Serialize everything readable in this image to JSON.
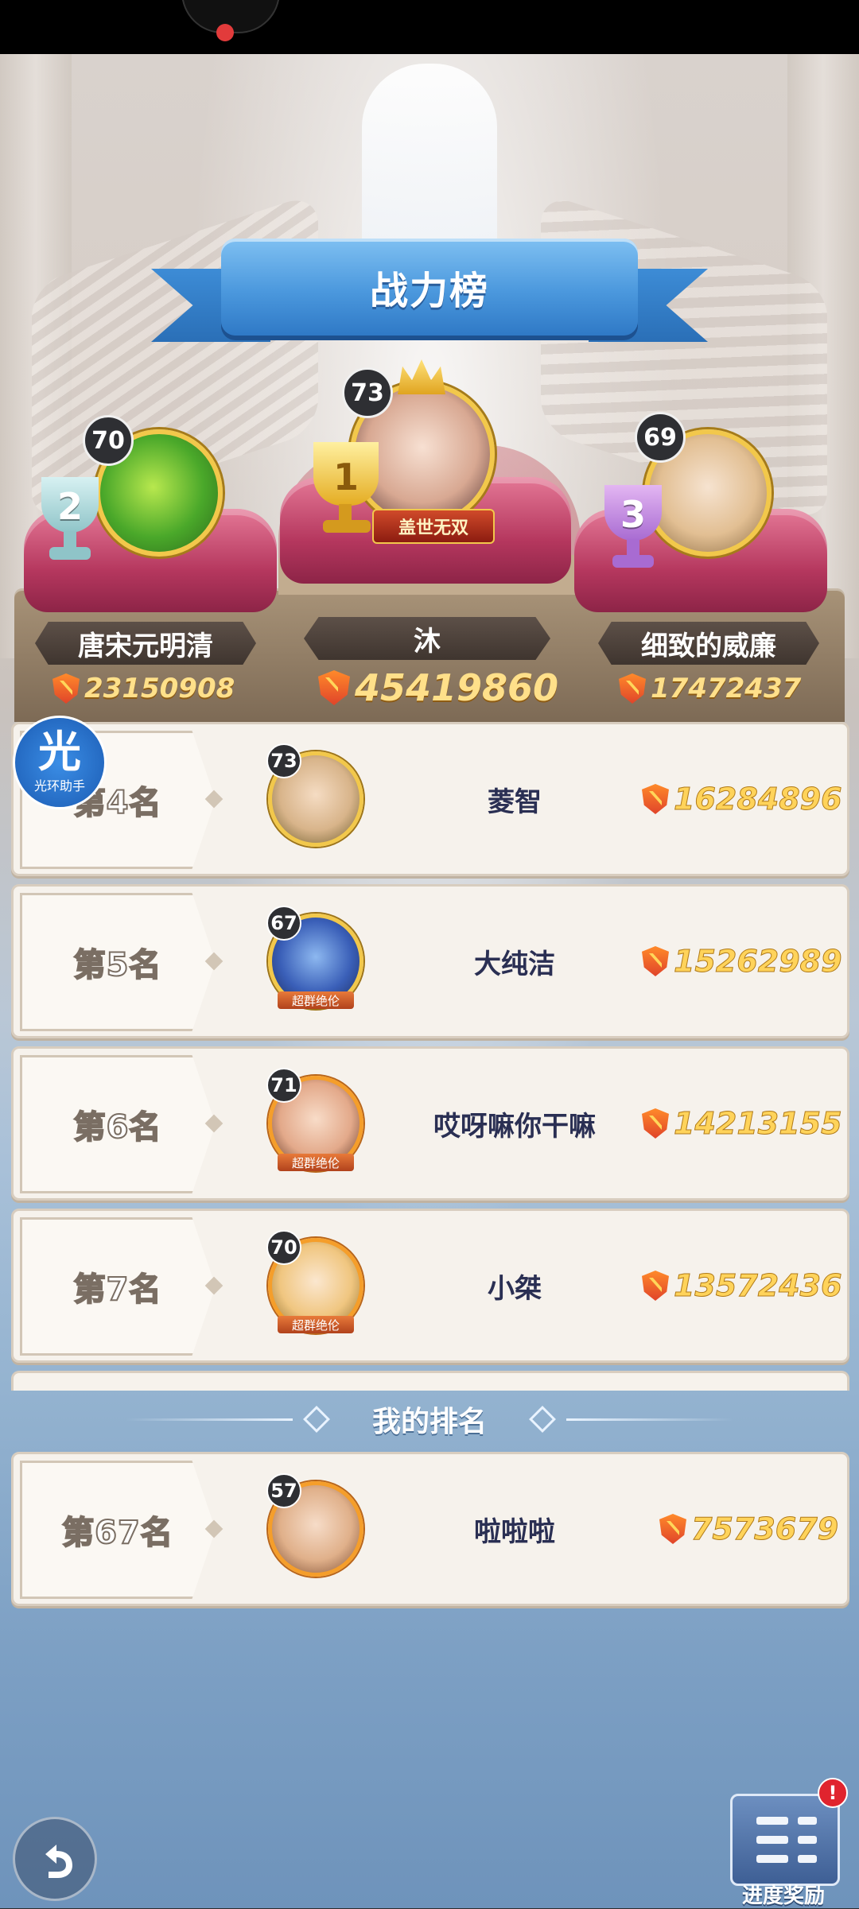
{
  "title": "战力榜",
  "top3": [
    {
      "rank": "2",
      "level": "70",
      "name": "唐宋元明清",
      "power": "23150908"
    },
    {
      "rank": "1",
      "level": "73",
      "name": "沐",
      "power": "45419860",
      "title_tag": "盖世无双"
    },
    {
      "rank": "3",
      "level": "69",
      "name": "细致的威廉",
      "power": "17472437"
    }
  ],
  "rows": [
    {
      "rank_label": "第4名",
      "level": "73",
      "name": "菱智",
      "power": "16284896"
    },
    {
      "rank_label": "第5名",
      "level": "67",
      "name": "大纯洁",
      "power": "15262989",
      "ribbon": "超群绝伦"
    },
    {
      "rank_label": "第6名",
      "level": "71",
      "name": "哎呀嘛你干嘛",
      "power": "14213155",
      "ribbon": "超群绝伦"
    },
    {
      "rank_label": "第7名",
      "level": "70",
      "name": "小桀",
      "power": "13572436",
      "ribbon": "超群绝伦"
    }
  ],
  "my_rank": {
    "section_label": "我的排名",
    "rank_label": "第67名",
    "level": "57",
    "name": "啦啦啦",
    "power": "7573679"
  },
  "helper": {
    "glyph": "光",
    "label": "光环助手"
  },
  "progress_reward": {
    "label": "进度奖励",
    "alert": "!"
  }
}
